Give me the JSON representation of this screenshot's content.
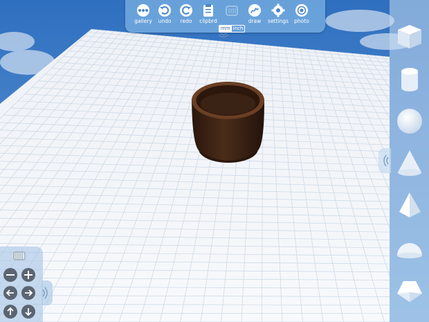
{
  "toolbar": {
    "gallery_label": "gallery",
    "undo_label": "undo",
    "redo_label": "redo",
    "clipboard_label": "clipbrd",
    "draw_label": "draw",
    "settings_label": "settings",
    "photo_label": "photo"
  },
  "units": {
    "mm_label": "mm",
    "inch_label": "inch",
    "selected": "mm"
  },
  "shapes": [
    "cube",
    "cylinder",
    "sphere",
    "cone",
    "pyramid",
    "hemisphere",
    "pentagonal-prism"
  ],
  "model": {
    "type": "hollow-cylinder",
    "color": "#3b2416"
  },
  "colors": {
    "accent": "#78afe1",
    "sky": "#3f80c8",
    "grid_line": "#c9d6e4",
    "plate": "#f4f6f9"
  }
}
